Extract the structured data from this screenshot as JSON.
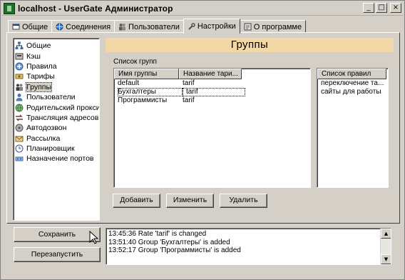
{
  "window": {
    "title": "localhost - UserGate Администратор",
    "controls": {
      "minimize": "_",
      "maximize": "□",
      "close": "×"
    }
  },
  "tabs": [
    {
      "label": "Общие",
      "icon": "settings-tab-icon"
    },
    {
      "label": "Соединения",
      "icon": "network-icon"
    },
    {
      "label": "Пользователи",
      "icon": "users-icon"
    },
    {
      "label": "Настройки",
      "icon": "tools-icon",
      "active": true
    },
    {
      "label": "О программе",
      "icon": "info-icon"
    }
  ],
  "sidebar": {
    "items": [
      {
        "label": "Общие",
        "icon": "network-tree-icon",
        "color": "#3a6ea5"
      },
      {
        "label": "Кэш",
        "icon": "cache-icon",
        "color": "#7a7a7a"
      },
      {
        "label": "Правила",
        "icon": "rules-icon",
        "color": "#2c5aa0"
      },
      {
        "label": "Тарифы",
        "icon": "tariff-icon",
        "color": "#b08a2e"
      },
      {
        "label": "Группы",
        "icon": "groups-icon",
        "color": "#5a5a5a",
        "selected": true
      },
      {
        "label": "Пользователи",
        "icon": "user-icon",
        "color": "#4a7ab0"
      },
      {
        "label": "Родительский прокси",
        "icon": "parent-proxy-icon",
        "color": "#3c7a3c"
      },
      {
        "label": "Трансляция адресов",
        "icon": "address-translation-icon",
        "color": "#7a3c3c"
      },
      {
        "label": "Автодозвон",
        "icon": "autodial-icon",
        "color": "#6a6a6a"
      },
      {
        "label": "Рассылка",
        "icon": "mailing-icon",
        "color": "#b07a2e"
      },
      {
        "label": "Планировщик",
        "icon": "scheduler-icon",
        "color": "#4a4a8a"
      },
      {
        "label": "Назначение портов",
        "icon": "port-mapping-icon",
        "color": "#3a6ea5"
      }
    ]
  },
  "main": {
    "header": "Группы",
    "groups_caption": "Список групп",
    "groups_table": {
      "columns": [
        "Имя группы",
        "Название тари..."
      ],
      "rows": [
        [
          "default",
          "tarif"
        ],
        [
          "Бухгалтеры",
          "tarif"
        ],
        [
          "Программисты",
          "tarif"
        ]
      ],
      "focused_row": 1
    },
    "rules_table": {
      "columns": [
        "Список правил"
      ],
      "rows": [
        [
          "переключение та..."
        ],
        [
          "сайты для работы"
        ]
      ]
    },
    "buttons": {
      "add": "Добавить",
      "edit": "Изменить",
      "delete": "Удалить",
      "save": "Сохранить",
      "restart": "Перезапустить"
    },
    "log": [
      "13:45:36 Rate 'tarif' is changed",
      "13:51:40 Group 'Бухгалтеры' is added",
      "13:52:17 Group 'Программисты' is added"
    ]
  },
  "colors": {
    "face": "#d4d0c8",
    "banner": "#f3d7a4"
  }
}
